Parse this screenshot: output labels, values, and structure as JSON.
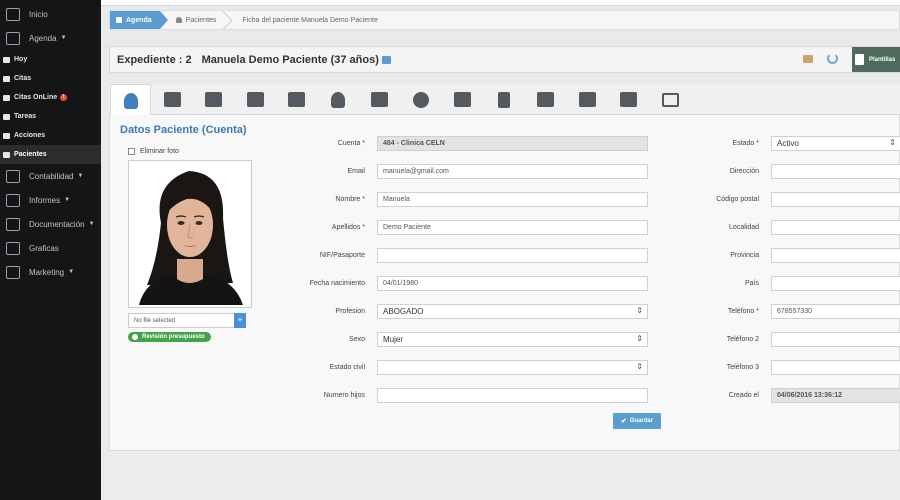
{
  "sidebar": {
    "items": [
      {
        "label": "Inicio",
        "icon": "home-icon",
        "size": "big",
        "caret": false
      },
      {
        "label": "Agenda",
        "icon": "calendar-icon",
        "size": "big",
        "caret": true
      },
      {
        "label": "Hoy",
        "icon": "check-icon",
        "size": "small",
        "caret": false
      },
      {
        "label": "Citas",
        "icon": "list-icon",
        "size": "small",
        "caret": false
      },
      {
        "label": "Citas OnLine",
        "icon": "globe-icon",
        "size": "small",
        "caret": false,
        "badge": "!"
      },
      {
        "label": "Tareas",
        "icon": "tasks-icon",
        "size": "small",
        "caret": false
      },
      {
        "label": "Acciones",
        "icon": "megaphone-icon",
        "size": "small",
        "caret": false
      },
      {
        "label": "Pacientes",
        "icon": "user-icon",
        "size": "small",
        "caret": false,
        "active": true
      },
      {
        "label": "Contabilidad",
        "icon": "book-icon",
        "size": "big",
        "caret": true
      },
      {
        "label": "Informes",
        "icon": "report-icon",
        "size": "big",
        "caret": true
      },
      {
        "label": "Documentación",
        "icon": "folder-icon",
        "size": "big",
        "caret": true
      },
      {
        "label": "Graficas",
        "icon": "bar-chart-icon",
        "size": "big",
        "caret": false
      },
      {
        "label": "Marketing",
        "icon": "rss-icon",
        "size": "big",
        "caret": true
      }
    ]
  },
  "breadcrumb": {
    "home": "Agenda",
    "item1": "Pacientes",
    "item2": "Ficha del paciente Manuela Demo Paciente"
  },
  "header": {
    "expediente": "Expediente : 2",
    "patient": "Manuela Demo Paciente (37 años)",
    "plantillas": "Plantillas"
  },
  "tabs": [
    "user-icon",
    "folder-open-icon",
    "group-icon",
    "calendar-icon",
    "megaphone-icon",
    "doctor-icon",
    "edit-icon",
    "stethoscope-icon",
    "credit-card-icon",
    "file-icon",
    "money-icon",
    "medkit-icon",
    "list-icon",
    "folder-icon"
  ],
  "panel": {
    "title": "Datos Paciente (Cuenta)",
    "delete_photo": "Eliminar foto",
    "file_placeholder": "No file selected",
    "badge": "Revisión presupuesto",
    "save": "Guardar"
  },
  "form_left": [
    {
      "label": "Cuenta *",
      "value": "484 - Clinica CELN",
      "readonly": true
    },
    {
      "label": "Email",
      "value": "manuela@gmail.com"
    },
    {
      "label": "Nombre *",
      "value": "Manuela"
    },
    {
      "label": "Apellidos *",
      "value": "Demo Paciente"
    },
    {
      "label": "NIF/Pasaporte",
      "value": ""
    },
    {
      "label": "Fecha nacimiento",
      "value": "04/01/1980"
    },
    {
      "label": "Profesion",
      "value": "ABOGADO",
      "select": true
    },
    {
      "label": "Sexo",
      "value": "Mujer",
      "select": true
    },
    {
      "label": "Estado civil",
      "value": "",
      "select": true
    },
    {
      "label": "Numero hijos",
      "value": ""
    }
  ],
  "form_right": [
    {
      "label": "Estado *",
      "value": "Activo",
      "select": true
    },
    {
      "label": "Dirección",
      "value": ""
    },
    {
      "label": "Código postal",
      "value": ""
    },
    {
      "label": "Localidad",
      "value": ""
    },
    {
      "label": "Provincia",
      "value": ""
    },
    {
      "label": "País",
      "value": ""
    },
    {
      "label": "Teléfono *",
      "value": "678557330"
    },
    {
      "label": "Teléfono 2",
      "value": ""
    },
    {
      "label": "Teléfono 3",
      "value": ""
    },
    {
      "label": "Creado el",
      "value": "04/06/2016 13:36:12",
      "readonly": true
    }
  ],
  "colors": {
    "sidebar_bg": "#141516",
    "accent": "#3e78b3",
    "breadcrumb_home": "#5b9bd1",
    "badge_green": "#44a24a",
    "save_button": "#5aa0cf"
  }
}
